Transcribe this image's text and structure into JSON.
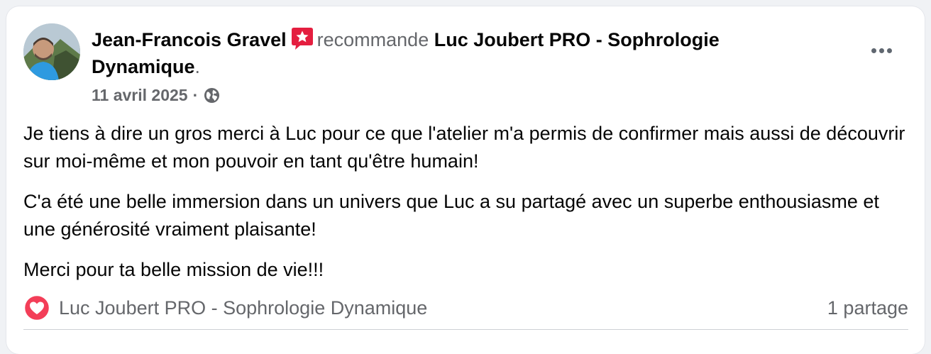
{
  "post": {
    "author": "Jean-Francois Gravel",
    "recommend_word": "recommande",
    "page_name": "Luc Joubert PRO - Sophrologie Dynamique",
    "period": ".",
    "date": "11 avril 2025",
    "dot": "·",
    "visibility_icon": "globe-icon",
    "recommend_icon": "recommend-star-icon",
    "more_icon": "more-options-icon",
    "paragraphs": [
      "Je tiens à dire un gros merci à Luc pour ce que l'atelier m'a permis de confirmer mais aussi de découvrir sur moi-même et mon pouvoir en tant qu'être humain!",
      "C'a été une belle immersion dans un univers que Luc a su partagé avec un superbe enthousiasme et une générosité vraiment plaisante!",
      "Merci pour ta belle mission de vie!!!"
    ]
  },
  "footer": {
    "reaction_icon": "love-reaction-icon",
    "reaction_by": "Luc Joubert PRO - Sophrologie Dynamique",
    "shares": "1 partage"
  },
  "colors": {
    "text_primary": "#050505",
    "text_secondary": "#65676b",
    "recommend_badge": "#e41e3f",
    "love_reaction": "#f33e58",
    "card_bg": "#ffffff",
    "page_bg": "#f0f2f5"
  }
}
